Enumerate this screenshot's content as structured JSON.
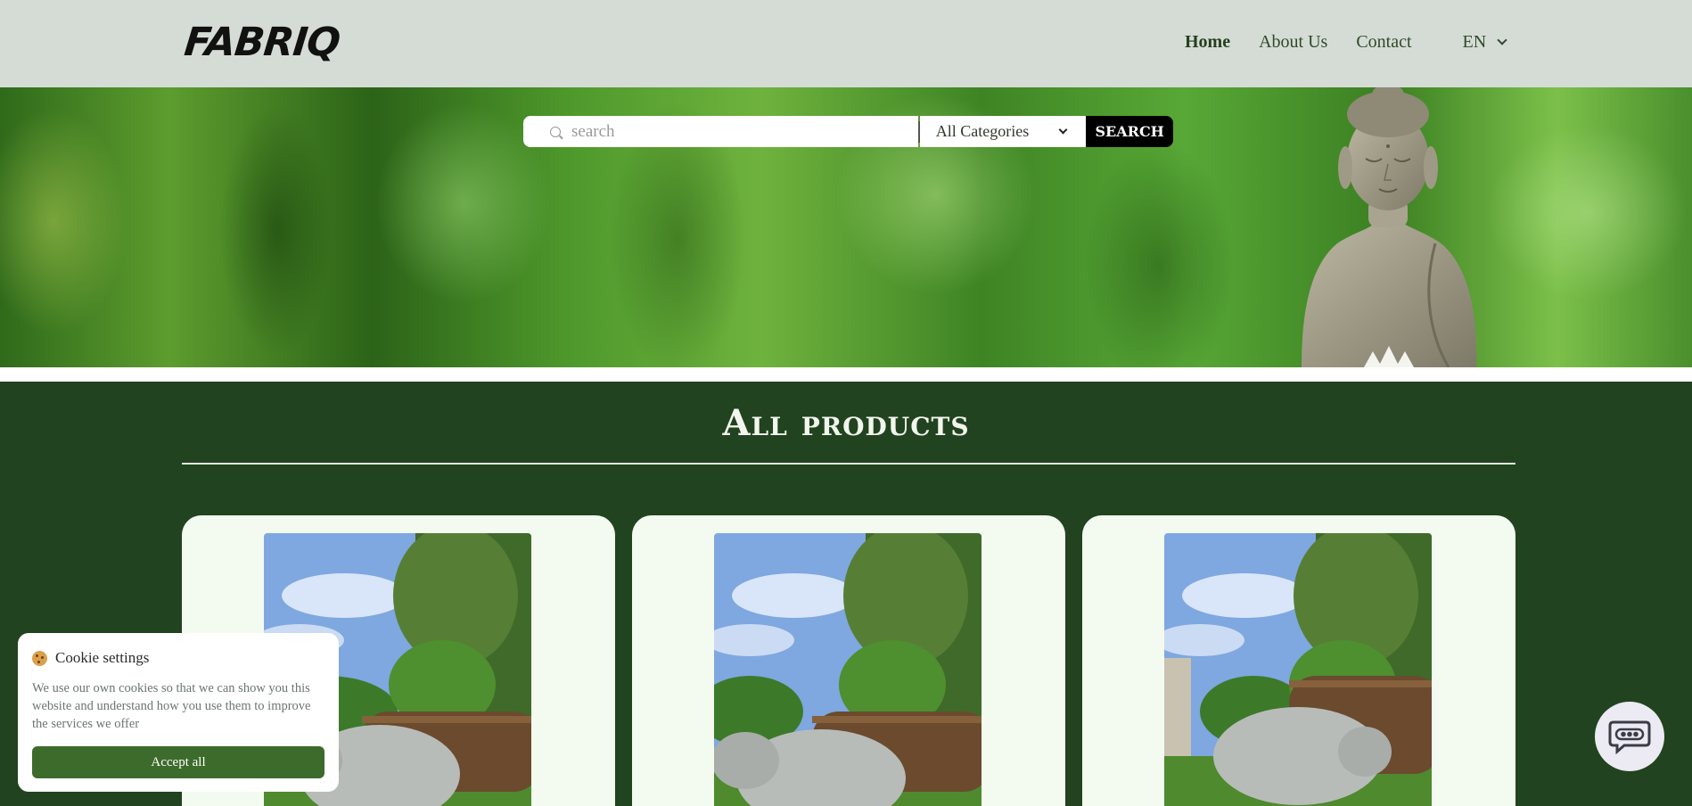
{
  "brand": {
    "logo_text": "FABRIQ"
  },
  "nav": {
    "links": [
      {
        "label": "Home",
        "active": true
      },
      {
        "label": "About Us",
        "active": false
      },
      {
        "label": "Contact",
        "active": false
      }
    ],
    "language": "EN"
  },
  "search": {
    "placeholder": "search",
    "category_selected": "All Categories",
    "button_label": "SEARCH"
  },
  "products": {
    "title": "All products",
    "cards": [
      {
        "image": "stone-pig-statue-photo"
      },
      {
        "image": "stone-pig-statue-photo"
      },
      {
        "image": "stone-pig-statue-photo"
      }
    ]
  },
  "cookie": {
    "title": "Cookie settings",
    "text": "We use our own cookies so that we can show you this website and understand how you use them to improve the services we offer",
    "accept_label": "Accept all"
  },
  "colors": {
    "header_bg": "#d5dcd5",
    "page_bg": "#21431f",
    "card_bg": "#f3fbf0",
    "accent_button": "#3d6b2c"
  },
  "icons": {
    "search": "search-icon",
    "chevron": "chevron-down-icon",
    "chat": "chat-bubble-icon",
    "cookie": "cookie-icon"
  }
}
